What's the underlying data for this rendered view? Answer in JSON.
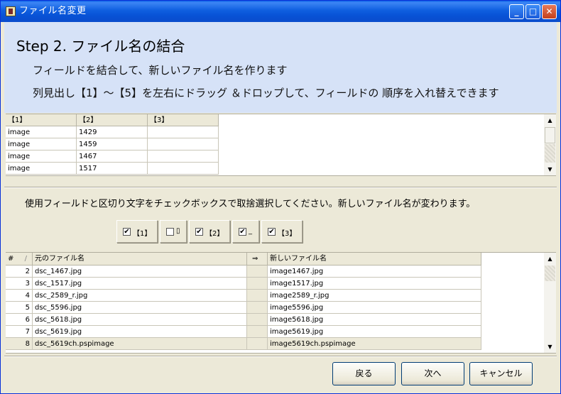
{
  "window": {
    "title": "ファイル名変更",
    "buttons": {
      "minimize": "_",
      "maximize": "□",
      "close": "✕"
    }
  },
  "header": {
    "step_title": "Step 2. ファイル名の結合",
    "desc1": "フィールドを結合して、新しいファイル名を作ります",
    "desc2": "列見出し【1】～【5】を左右にドラッグ ＆ドロップして、フィールドの 順序を入れ替えできます"
  },
  "field_table": {
    "columns": [
      "【1】",
      "【2】",
      "【3】"
    ],
    "rows": [
      [
        "image",
        "1429",
        ""
      ],
      [
        "image",
        "1459",
        ""
      ],
      [
        "image",
        "1467",
        ""
      ],
      [
        "image",
        "1517",
        ""
      ]
    ]
  },
  "instruction": "使用フィールドと区切り文字をチェックボックスで取捨選択してください。新しいファイル名が変わります。",
  "checkboxes": [
    {
      "label": "【1】",
      "checked": "✔"
    },
    {
      "label": "▯",
      "checked": ""
    },
    {
      "label": "【2】",
      "checked": "✔"
    },
    {
      "label": "_",
      "checked": "✔"
    },
    {
      "label": "【3】",
      "checked": "✔"
    }
  ],
  "file_table": {
    "headers": {
      "num": "#",
      "sort": "/",
      "original": "元のファイル名",
      "arrow": "⇒",
      "new": "新しいファイル名"
    },
    "rows": [
      {
        "num": "2",
        "original": "dsc_1467.jpg",
        "new": "image1467.jpg"
      },
      {
        "num": "3",
        "original": "dsc_1517.jpg",
        "new": "image1517.jpg"
      },
      {
        "num": "4",
        "original": "dsc_2589_r.jpg",
        "new": "image2589_r.jpg"
      },
      {
        "num": "5",
        "original": "dsc_5596.jpg",
        "new": "image5596.jpg"
      },
      {
        "num": "6",
        "original": "dsc_5618.jpg",
        "new": "image5618.jpg"
      },
      {
        "num": "7",
        "original": "dsc_5619.jpg",
        "new": "image5619.jpg"
      },
      {
        "num": "8",
        "original": "dsc_5619ch.pspimage",
        "new": "image5619ch.pspimage"
      }
    ]
  },
  "scroll": {
    "up": "▲",
    "down": "▼"
  },
  "footer": {
    "back": "戻る",
    "next": "次へ",
    "cancel": "キャンセル"
  }
}
